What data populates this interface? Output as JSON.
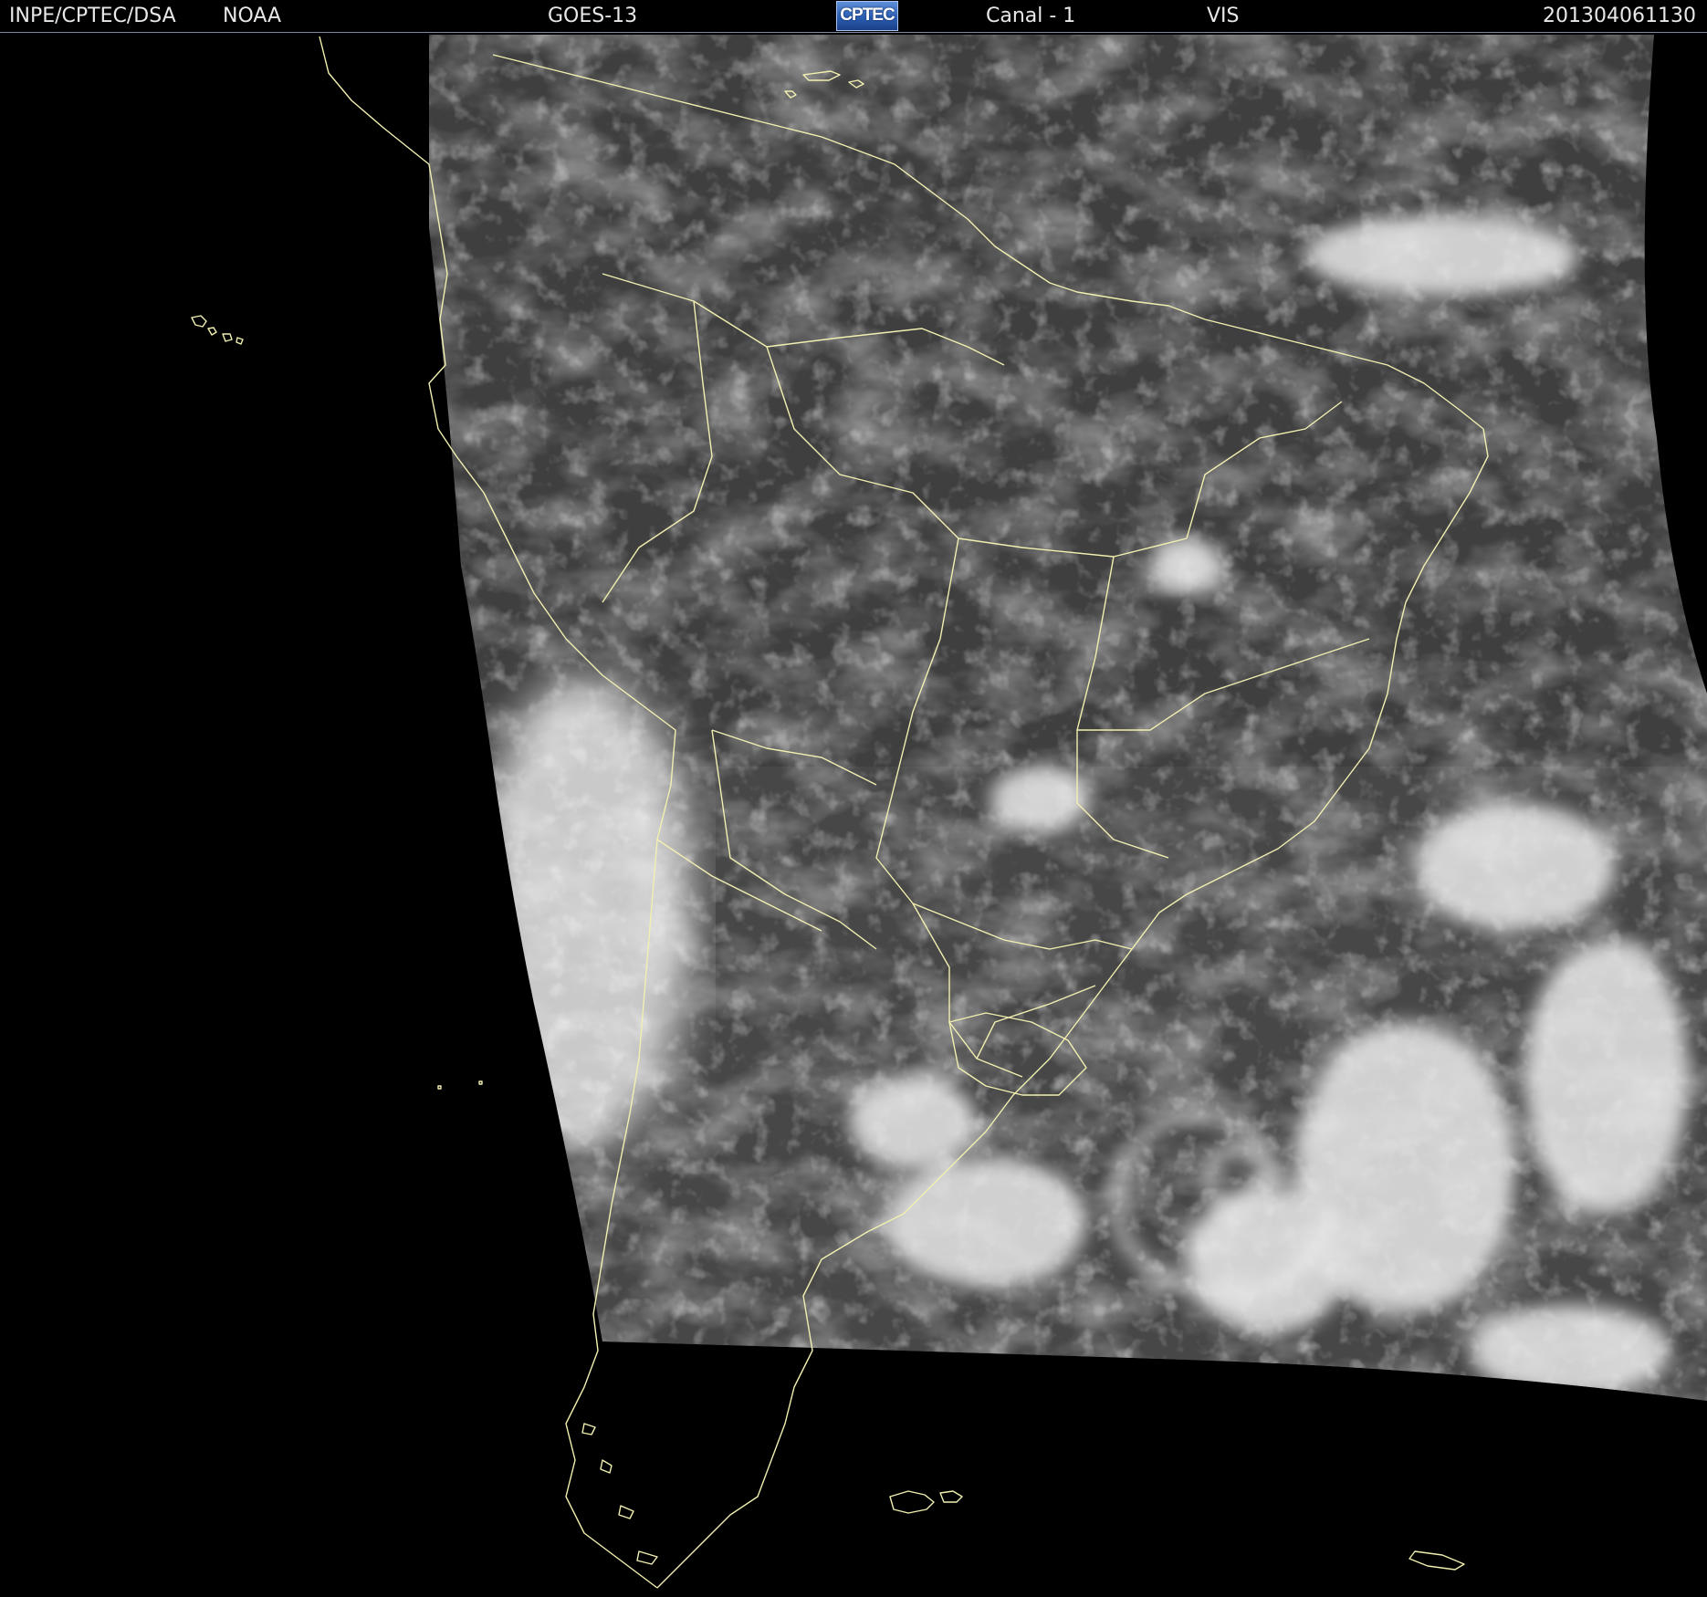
{
  "header": {
    "institute": "INPE/CPTEC/DSA",
    "agency": "NOAA",
    "satellite": "GOES-13",
    "logo_text": "CPTEC",
    "channel": "Canal - 1",
    "band": "VIS",
    "timestamp": "201304061130"
  },
  "colors": {
    "background": "#000000",
    "coastline": "#f2f0b0",
    "header_text": "#e8e8e8",
    "logo_blue": "#2c5fb3"
  }
}
